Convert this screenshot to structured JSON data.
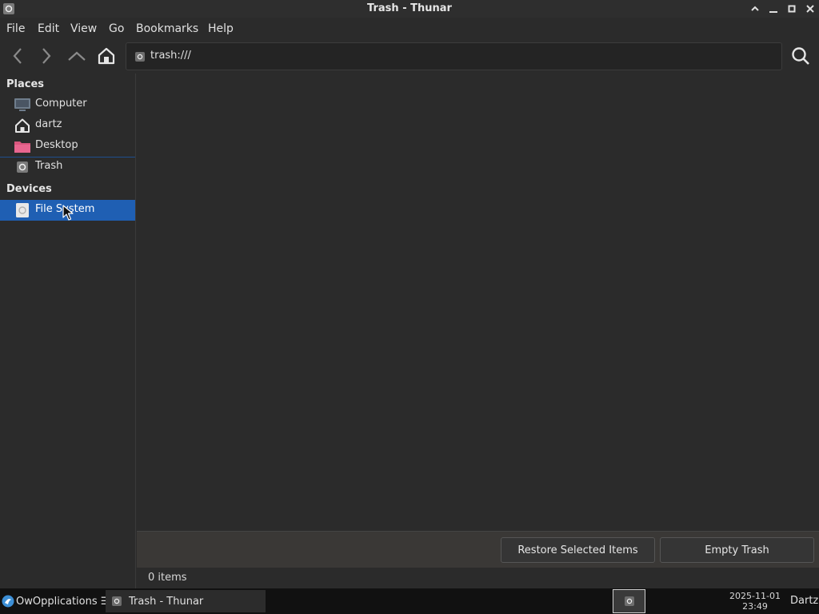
{
  "window": {
    "title": "Trash - Thunar",
    "app_icon": "trash-icon",
    "controls": [
      "maximize-up-icon",
      "minimize-icon",
      "restore-icon",
      "close-icon"
    ]
  },
  "menubar": {
    "file": "File",
    "edit": "Edit",
    "view": "View",
    "go": "Go",
    "bookmarks": "Bookmarks",
    "help": "Help"
  },
  "toolbar": {
    "back_icon": "chevron-left-icon",
    "forward_icon": "chevron-right-icon",
    "up_icon": "chevron-up-icon",
    "home_icon": "home-icon",
    "location": "trash:///",
    "search_icon": "search-icon"
  },
  "sidebar": {
    "places_header": "Places",
    "places": [
      {
        "label": "Computer",
        "icon": "computer-icon"
      },
      {
        "label": "dartz",
        "icon": "home-icon"
      },
      {
        "label": "Desktop",
        "icon": "folder-icon"
      },
      {
        "label": "Trash",
        "icon": "trash-icon"
      }
    ],
    "devices_header": "Devices",
    "devices": [
      {
        "label": "File System",
        "icon": "drive-icon",
        "selected": true
      }
    ]
  },
  "actions": {
    "restore": "Restore Selected Items",
    "empty": "Empty Trash"
  },
  "status": {
    "items": "0 items"
  },
  "taskbar": {
    "start_label": "OwOpplications ☰",
    "task_label": "Trash - Thunar",
    "clock_date": "2025-11-01",
    "clock_time": "23:49",
    "user": "Dartz"
  },
  "colors": {
    "selection": "#1f5fb3",
    "background": "#2b2b2b",
    "taskbar": "#111111"
  }
}
